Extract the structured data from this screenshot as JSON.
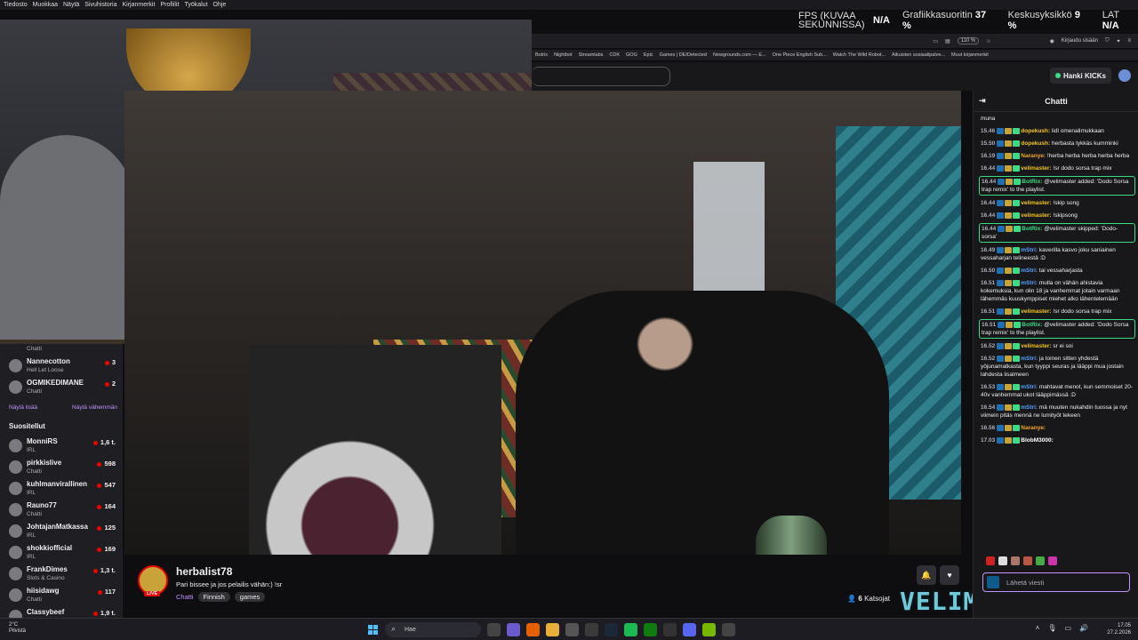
{
  "menubar": [
    "Tiedosto",
    "Muokkaa",
    "Näytä",
    "Sivuhistoria",
    "Kirjanmerkit",
    "Profiilit",
    "Työkalut",
    "Ohje"
  ],
  "perf": {
    "fps_label": "FPS (KUVAA SEKUNNISSA)",
    "fps_value": "N/A",
    "gpu_label": "Grafiikkasuoritin",
    "gpu_value": "37 %",
    "mem_label": "Keskusyksikkö",
    "mem_value": "9 %",
    "lat_label": "LAT",
    "lat_value": "N/A"
  },
  "toolbar": {
    "zoom": "110 %",
    "login": "Kirjaudu sisään"
  },
  "bookmarks": [
    "Botrix",
    "Nightbot",
    "Streamlabs",
    "CDK",
    "GOG",
    "Epic",
    "Games | DEIDetected",
    "Newgrounds.com — E...",
    "One Piece English Sub...",
    "Watch The Wild Robot...",
    "Aikuisten sosiaalipalve...",
    "Muut kirjanmerkit"
  ],
  "kicks": "Hanki KICKs",
  "sidebar": {
    "top_items": [
      {
        "game": "Chatti"
      },
      {
        "name": "Nannecotton",
        "game": "Hell Let Loose",
        "viewers": "3"
      },
      {
        "name": "OGMIKEDIMANE",
        "game": "Chatti",
        "viewers": "2"
      }
    ],
    "show_more": "Näytä lisää",
    "show_less": "Näytä vähemmän",
    "recommended_title": "Suositellut",
    "recommended": [
      {
        "name": "MonniRS",
        "game": "IRL",
        "viewers": "1,6 t."
      },
      {
        "name": "pirkkislive",
        "game": "Chatti",
        "viewers": "598"
      },
      {
        "name": "kuhlmanvirallinen",
        "game": "IRL",
        "viewers": "547"
      },
      {
        "name": "Rauno77",
        "game": "Chatti",
        "viewers": "164"
      },
      {
        "name": "JohtajanMatkassa",
        "game": "IRL",
        "viewers": "125"
      },
      {
        "name": "shokkiofficial",
        "game": "IRL",
        "viewers": "169"
      },
      {
        "name": "FrankDimes",
        "game": "Slots & Casino",
        "viewers": "1,3 t."
      },
      {
        "name": "hiisidawg",
        "game": "Chatti",
        "viewers": "117"
      },
      {
        "name": "Classybeef",
        "game": "",
        "viewers": "1,9 t."
      }
    ]
  },
  "channel": {
    "name": "herbalist78",
    "title": "Pari bissee ja jos pelailis vähän:) !sr",
    "category": "Chatti",
    "tags": [
      "Finnish",
      "games"
    ],
    "live": "LIVE",
    "viewers": "6",
    "viewers_label": "Katsojat"
  },
  "overlay_text": "VELIMASTER",
  "chat": {
    "title": "Chatti",
    "input_placeholder": "Lähetä viesti",
    "messages": [
      {
        "time": "",
        "user": "",
        "text": "muna",
        "color": "#efeff1",
        "highlight": false
      },
      {
        "time": "15.46",
        "user": "dopekush:",
        "text": "lidl omenalimukkaan",
        "color": "#f5c518",
        "highlight": false
      },
      {
        "time": "15.50",
        "user": "dopekush:",
        "text": "herbasta tykkäs kumminki",
        "color": "#f5c518",
        "highlight": false
      },
      {
        "time": "16.19",
        "user": "Naranye:",
        "text": "!herba herba herba herba herba",
        "color": "#f5a623",
        "highlight": false
      },
      {
        "time": "16.44",
        "user": "velimaster:",
        "text": "!sr dodo sorsa trap mix",
        "color": "#f5c518",
        "highlight": false
      },
      {
        "time": "16.44",
        "user": "BotRix:",
        "text": "@velimaster added: 'Dodo Sorsa trap remix' to the playlist.",
        "color": "#3ddc84",
        "highlight": true
      },
      {
        "time": "16.44",
        "user": "velimaster:",
        "text": "!skip song",
        "color": "#f5c518",
        "highlight": false
      },
      {
        "time": "16.44",
        "user": "velimaster:",
        "text": "!skipsong",
        "color": "#f5c518",
        "highlight": false
      },
      {
        "time": "16.44",
        "user": "BotRix:",
        "text": "@velimaster skipped: 'Dodo-sorsa'",
        "color": "#3ddc84",
        "highlight": true
      },
      {
        "time": "16.49",
        "user": "mStri:",
        "text": "kaverilla kasvo joku saniainen vessaharjan telineestä :D",
        "color": "#5aa0ff",
        "highlight": false
      },
      {
        "time": "16.50",
        "user": "mStri:",
        "text": "tai vessaharjasta",
        "color": "#5aa0ff",
        "highlight": false
      },
      {
        "time": "16.51",
        "user": "mStri:",
        "text": "mulla on vähän ahistavia kokemuksia, kun olin 18 ja vanhemmat jotain varmaan lähemmäs kuuskymppiset miehet alko lähentelemään",
        "color": "#5aa0ff",
        "highlight": false
      },
      {
        "time": "16.51",
        "user": "velimaster:",
        "text": "!sr dodo sorsa trap mix",
        "color": "#f5c518",
        "highlight": false
      },
      {
        "time": "16.51",
        "user": "BotRix:",
        "text": "@velimaster added: 'Dodo Sorsa trap remix' to the playlist.",
        "color": "#3ddc84",
        "highlight": true
      },
      {
        "time": "16.52",
        "user": "velimaster:",
        "text": "sr ei soi",
        "color": "#f5c518",
        "highlight": false
      },
      {
        "time": "16.52",
        "user": "mStri:",
        "text": "ja toinen sitten yhdestä yöjunamatkasta, kun tyyppi seuras ja lääppi mua jostain lahdesta iisalmeen",
        "color": "#5aa0ff",
        "highlight": false
      },
      {
        "time": "16.53",
        "user": "mStri:",
        "text": "mahtavat menot, kun semmoiset 20-40v vanhemmat ukot lääppimässä :D",
        "color": "#5aa0ff",
        "highlight": false
      },
      {
        "time": "16.54",
        "user": "mStri:",
        "text": "mä muuten nukahdin tuossa ja nyt viimein pitäs mennä ne lumityöt tekeen",
        "color": "#5aa0ff",
        "highlight": false
      },
      {
        "time": "16.56",
        "user": "Naranye:",
        "text": "",
        "color": "#f5a623",
        "highlight": false
      },
      {
        "time": "17.03",
        "user": "BlobM3000:",
        "text": "",
        "color": "#ffffff",
        "highlight": false
      }
    ]
  },
  "taskbar": {
    "weather_temp": "2°C",
    "weather_desc": "Pilvistä",
    "search": "Hae",
    "time": "17.05",
    "date": "27.2.2026"
  }
}
